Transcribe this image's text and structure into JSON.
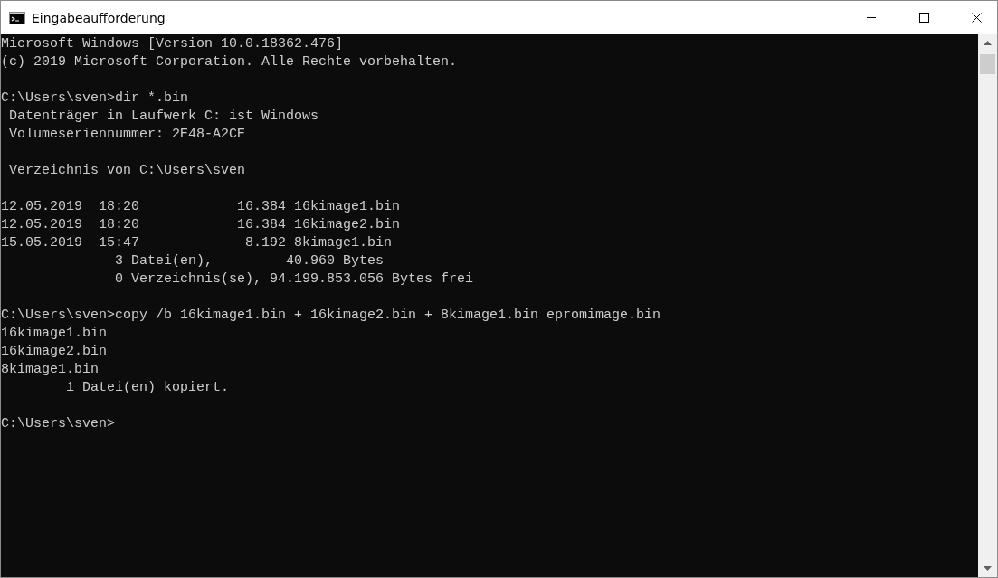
{
  "window": {
    "title": "Eingabeaufforderung"
  },
  "console": {
    "blocks": [
      [
        "Microsoft Windows [Version 10.0.18362.476]",
        "(c) 2019 Microsoft Corporation. Alle Rechte vorbehalten."
      ],
      [
        "C:\\Users\\sven>dir *.bin",
        " Datenträger in Laufwerk C: ist Windows",
        " Volumeseriennummer: 2E48-A2CE"
      ],
      [
        " Verzeichnis von C:\\Users\\sven"
      ],
      [
        "12.05.2019  18:20            16.384 16kimage1.bin",
        "12.05.2019  18:20            16.384 16kimage2.bin",
        "15.05.2019  15:47             8.192 8kimage1.bin",
        "              3 Datei(en),         40.960 Bytes",
        "              0 Verzeichnis(se), 94.199.853.056 Bytes frei"
      ],
      [
        "C:\\Users\\sven>copy /b 16kimage1.bin + 16kimage2.bin + 8kimage1.bin epromimage.bin",
        "16kimage1.bin",
        "16kimage2.bin",
        "8kimage1.bin",
        "        1 Datei(en) kopiert."
      ],
      [
        "C:\\Users\\sven>"
      ]
    ]
  }
}
